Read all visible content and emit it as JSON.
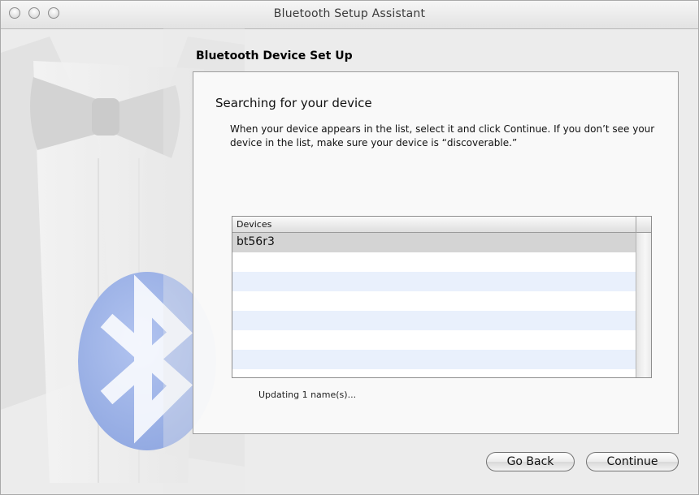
{
  "window": {
    "title": "Bluetooth Setup Assistant",
    "controls": [
      "close",
      "minimize",
      "zoom"
    ]
  },
  "section_title": "Bluetooth Device Set Up",
  "panel": {
    "heading": "Searching for your device",
    "instructions": "When your device appears in the list, select it and click Continue. If you don’t see your device in the list, make sure your device is “discoverable.”"
  },
  "device_table": {
    "column_header": "Devices",
    "rows": [
      "bt56r3"
    ],
    "selected_row": "bt56r3"
  },
  "status_text": "Updating 1 name(s)...",
  "buttons": {
    "back": "Go Back",
    "continue": "Continue"
  },
  "colors": {
    "window_bg": "#ececec",
    "selected_row": "#d4d4d4",
    "alt_row": "#e9f0fc",
    "bluetooth_logo": "#9ab0e6"
  }
}
